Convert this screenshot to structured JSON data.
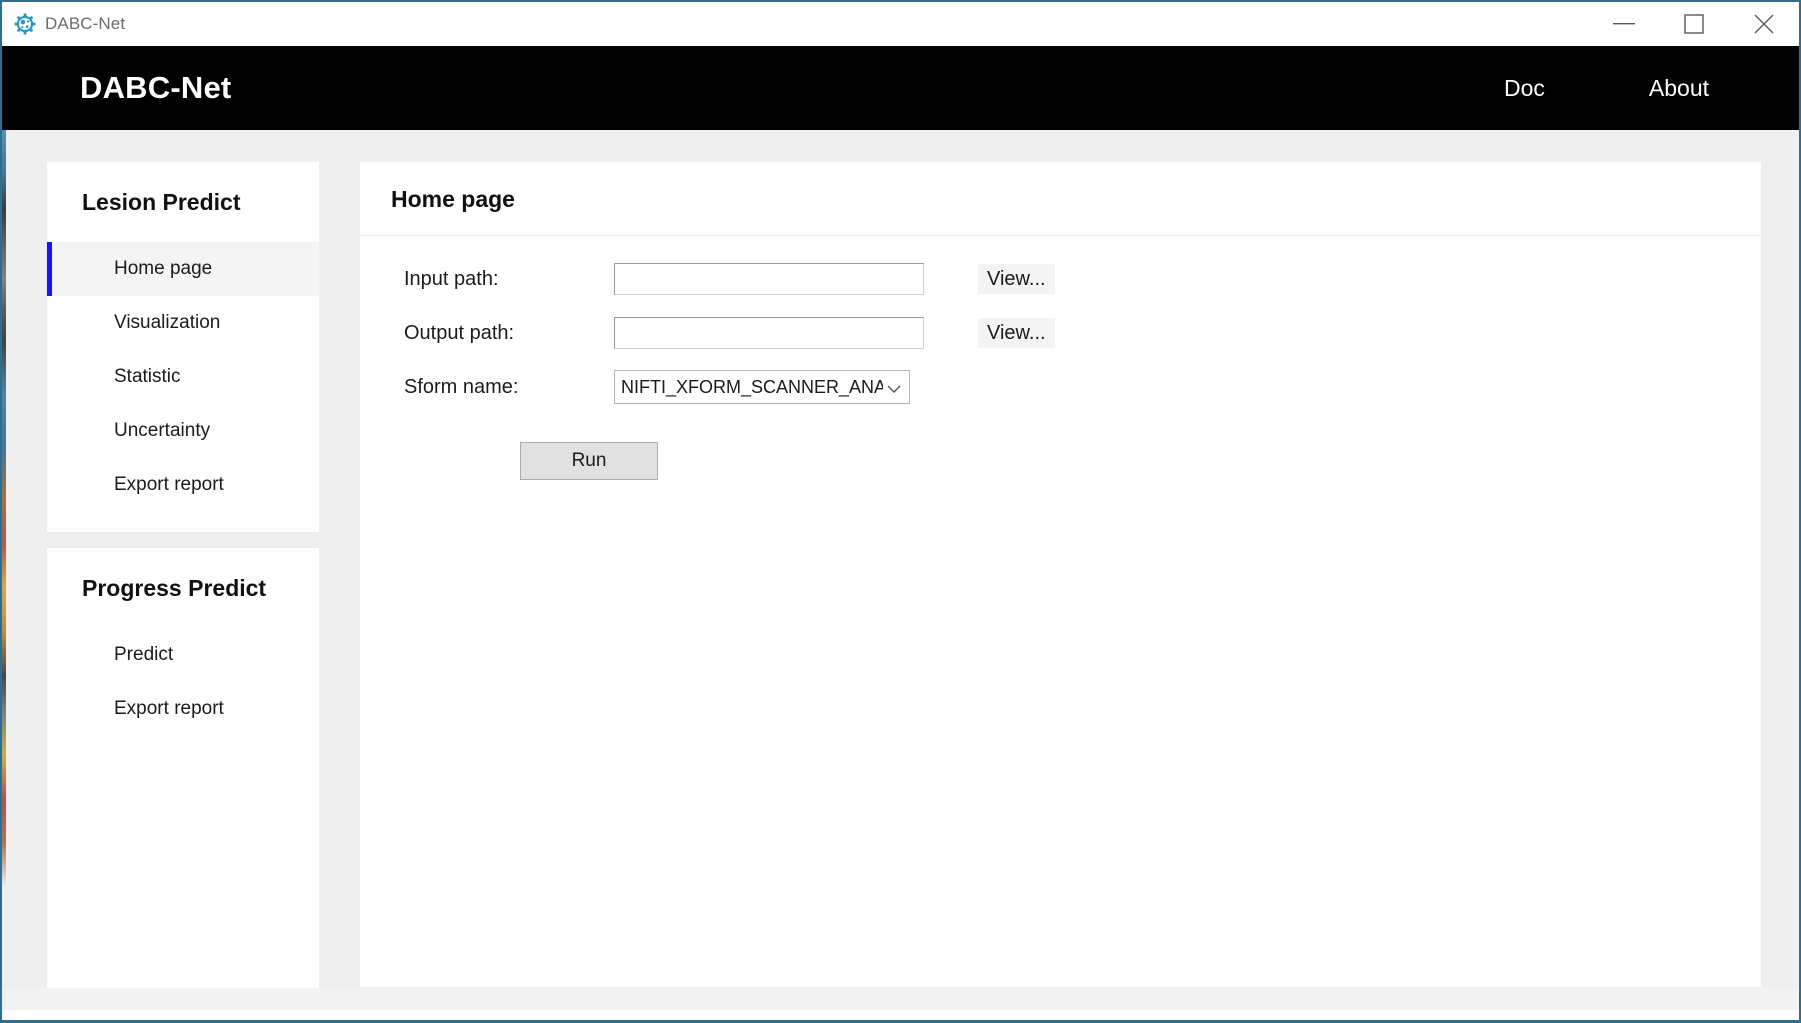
{
  "window": {
    "title": "DABC-Net",
    "app_icon": "gear-virus-icon",
    "controls": {
      "minimize": "minimize-icon",
      "maximize": "maximize-icon",
      "close": "close-icon"
    }
  },
  "navbar": {
    "brand": "DABC-Net",
    "links": [
      {
        "label": "Doc",
        "name": "doc"
      },
      {
        "label": "About",
        "name": "about"
      }
    ]
  },
  "sidebar": {
    "sections": [
      {
        "title": "Lesion Predict",
        "items": [
          {
            "label": "Home page",
            "active": true
          },
          {
            "label": "Visualization",
            "active": false
          },
          {
            "label": "Statistic",
            "active": false
          },
          {
            "label": "Uncertainty",
            "active": false
          },
          {
            "label": "Export report",
            "active": false
          }
        ]
      },
      {
        "title": "Progress Predict",
        "items": [
          {
            "label": "Predict",
            "active": false
          },
          {
            "label": "Export report",
            "active": false
          }
        ]
      }
    ]
  },
  "main": {
    "header": "Home page",
    "form": {
      "input_path": {
        "label": "Input path:",
        "value": "",
        "placeholder": "",
        "button": "View..."
      },
      "output_path": {
        "label": "Output path:",
        "value": "",
        "placeholder": "",
        "button": "View..."
      },
      "sform_name": {
        "label": "Sform name:",
        "value": "NIFTI_XFORM_SCANNER_ANAT",
        "options": [
          "NIFTI_XFORM_SCANNER_ANAT"
        ]
      },
      "run_button": "Run"
    }
  },
  "colors": {
    "navbar_bg": "#000000",
    "page_bg": "#efefef",
    "card_bg": "#ffffff",
    "active_accent": "#1414ff",
    "window_border": "#2e6e8e",
    "button_bg": "#e1e1e1"
  }
}
